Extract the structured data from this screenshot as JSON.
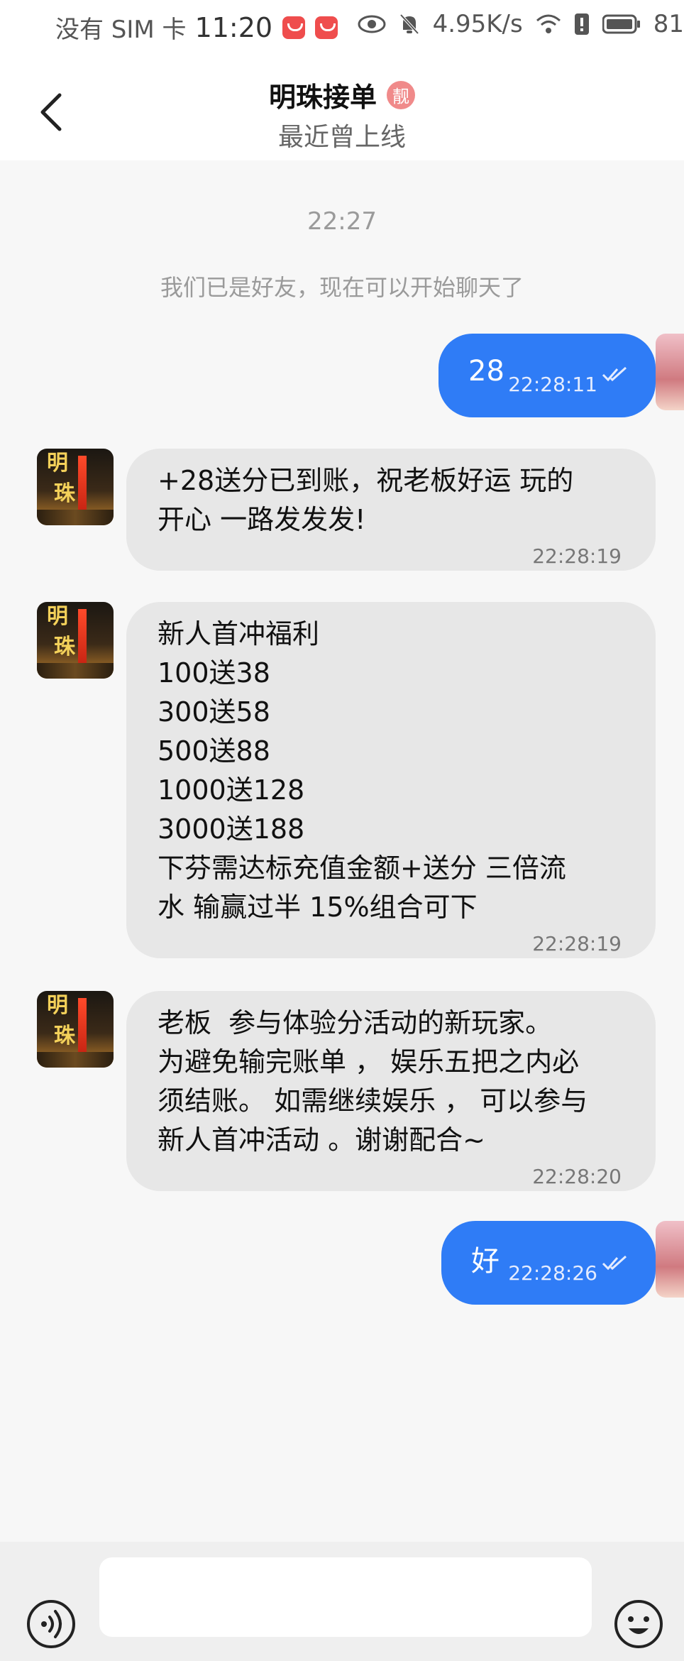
{
  "status_bar": {
    "carrier": "没有 SIM 卡",
    "time": "11:20",
    "net_speed": "4.95K/s",
    "battery": "81"
  },
  "header": {
    "title": "明珠接单",
    "badge": "靓",
    "subtitle": "最近曾上线"
  },
  "chat": {
    "timestamp": "22:27",
    "system_message": "我们已是好友，现在可以开始聊天了",
    "messages": [
      {
        "direction": "out",
        "text": "28",
        "time": "22:28:11"
      },
      {
        "direction": "in",
        "text": "+28送分已到账，祝老板好运 玩的\n开心 一路发发发!",
        "time": "22:28:19"
      },
      {
        "direction": "in",
        "text": "新人首冲福利\n100送38\n300送58\n500送88\n1000送128\n3000送188\n下芬需达标充值金额+送分 三倍流\n水 输赢过半 15%组合可下",
        "time": "22:28:19"
      },
      {
        "direction": "in",
        "text": "老板  参与体验分活动的新玩家。\n为避免输完账单 ， 娱乐五把之内必\n须结账。 如需继续娱乐 ， 可以参与\n新人首冲活动 。谢谢配合~",
        "time": "22:28:20"
      },
      {
        "direction": "out",
        "text": "好",
        "time": "22:28:26"
      }
    ]
  },
  "avatar": {
    "line1": "明",
    "line2": "珠"
  },
  "input": {
    "placeholder": ""
  },
  "colors": {
    "accent": "#2f7cf6",
    "incoming_bubble": "#e7e7e7",
    "background": "#f7f7f7"
  },
  "icons": [
    "back-arrow-icon",
    "eye-icon",
    "bell-off-icon",
    "wifi-icon",
    "battery-icon",
    "double-check-icon",
    "voice-icon",
    "emoji-icon"
  ]
}
